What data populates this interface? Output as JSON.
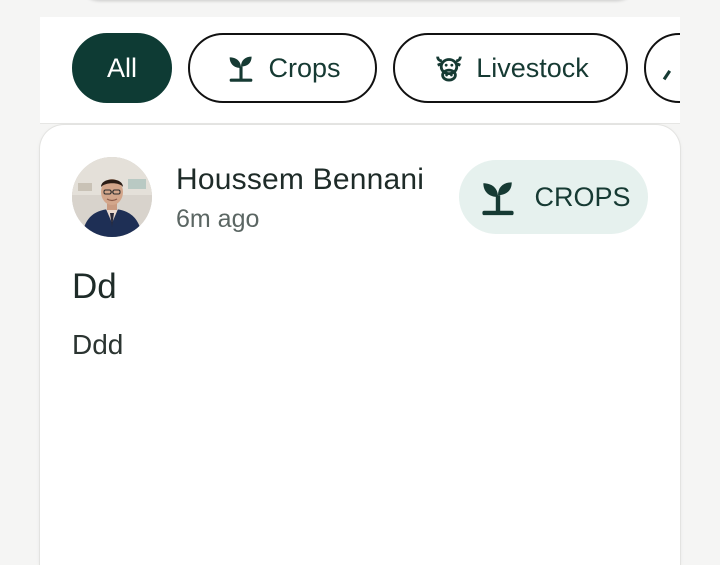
{
  "filters": {
    "chips": [
      {
        "label": "All",
        "icon": "",
        "active": true
      },
      {
        "label": "Crops",
        "icon": "sprout-icon",
        "active": false
      },
      {
        "label": "Livestock",
        "icon": "cow-icon",
        "active": false
      }
    ]
  },
  "post": {
    "author": "Houssem Bennani",
    "time_ago": "6m ago",
    "category": "CROPS",
    "category_icon": "sprout-icon",
    "title": "Dd",
    "body": "Ddd"
  },
  "colors": {
    "accent": "#0e3b34",
    "badge_bg": "#e6f1ee",
    "page_bg": "#f5f5f4"
  }
}
